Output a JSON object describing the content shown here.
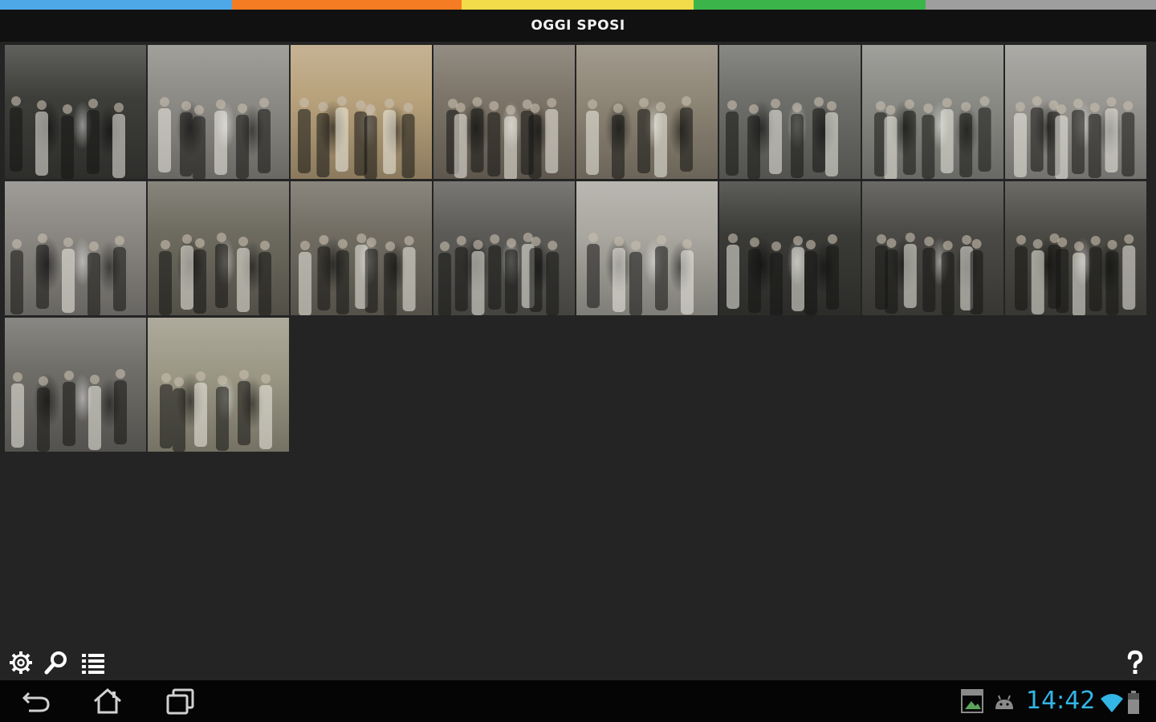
{
  "app": {
    "title": "OGGI SPOSI",
    "accent_strip_colors": [
      "#4ea8e8",
      "#f57c22",
      "#f2dc4a",
      "#3bb54a",
      "#9e9e9e"
    ]
  },
  "gallery": {
    "photos": [
      {
        "tone": "#3d3d3a"
      },
      {
        "tone": "#8d8b85"
      },
      {
        "tone": "#b8a27c"
      },
      {
        "tone": "#7c7468"
      },
      {
        "tone": "#8e8676"
      },
      {
        "tone": "#6e6e6a"
      },
      {
        "tone": "#8b8b86"
      },
      {
        "tone": "#9a9893"
      },
      {
        "tone": "#8a8782"
      },
      {
        "tone": "#6d6a5f"
      },
      {
        "tone": "#706c62"
      },
      {
        "tone": "#5b5a56"
      },
      {
        "tone": "#a9a79f"
      },
      {
        "tone": "#3a3a37"
      },
      {
        "tone": "#4a4945"
      },
      {
        "tone": "#4b4a44"
      },
      {
        "tone": "#6f6d68"
      },
      {
        "tone": "#9c9886"
      }
    ]
  },
  "toolbar": {
    "icons": [
      "settings-icon",
      "search-icon",
      "list-icon",
      "help-icon"
    ]
  },
  "system_bar": {
    "time": "14:42",
    "nav_icons": [
      "back-icon",
      "home-icon",
      "recent-apps-icon"
    ],
    "status_icons": [
      "gallery-notification-icon",
      "android-icon",
      "wifi-icon",
      "battery-icon"
    ],
    "accent_color": "#33b5e5"
  }
}
